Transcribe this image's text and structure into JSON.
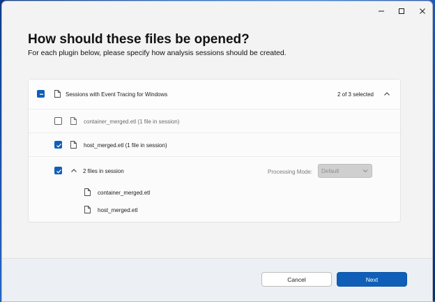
{
  "window": {
    "controls": [
      "minimize",
      "maximize",
      "close"
    ]
  },
  "dialog": {
    "title": "How should these files be opened?",
    "subtitle": "For each plugin below, please specify how analysis sessions should be created."
  },
  "group": {
    "label": "Sessions with Event Tracing for Windows",
    "count": "2 of 3 selected",
    "state": "indeterminate",
    "expanded": true
  },
  "sessions": [
    {
      "label": "container_merged.etl (1 file in session)",
      "checked": false
    },
    {
      "label": "host_merged.etl (1 file in session)",
      "checked": true
    },
    {
      "label": "2 files in session",
      "checked": true,
      "expanded": true,
      "processing_mode_label": "Processing Mode:",
      "processing_mode_value": "Default",
      "files": [
        "container_merged.etl",
        "host_merged.etl"
      ]
    }
  ],
  "footer": {
    "cancel_label": "Cancel",
    "next_label": "Next"
  },
  "colors": {
    "accent": "#0f5fb8",
    "background": "#f3f3f3",
    "footer": "#eceff4"
  },
  "icons": [
    "minimize-icon",
    "maximize-icon",
    "close-icon",
    "file-icon",
    "chevron-up-icon",
    "chevron-down-icon",
    "checkmark-icon"
  ]
}
